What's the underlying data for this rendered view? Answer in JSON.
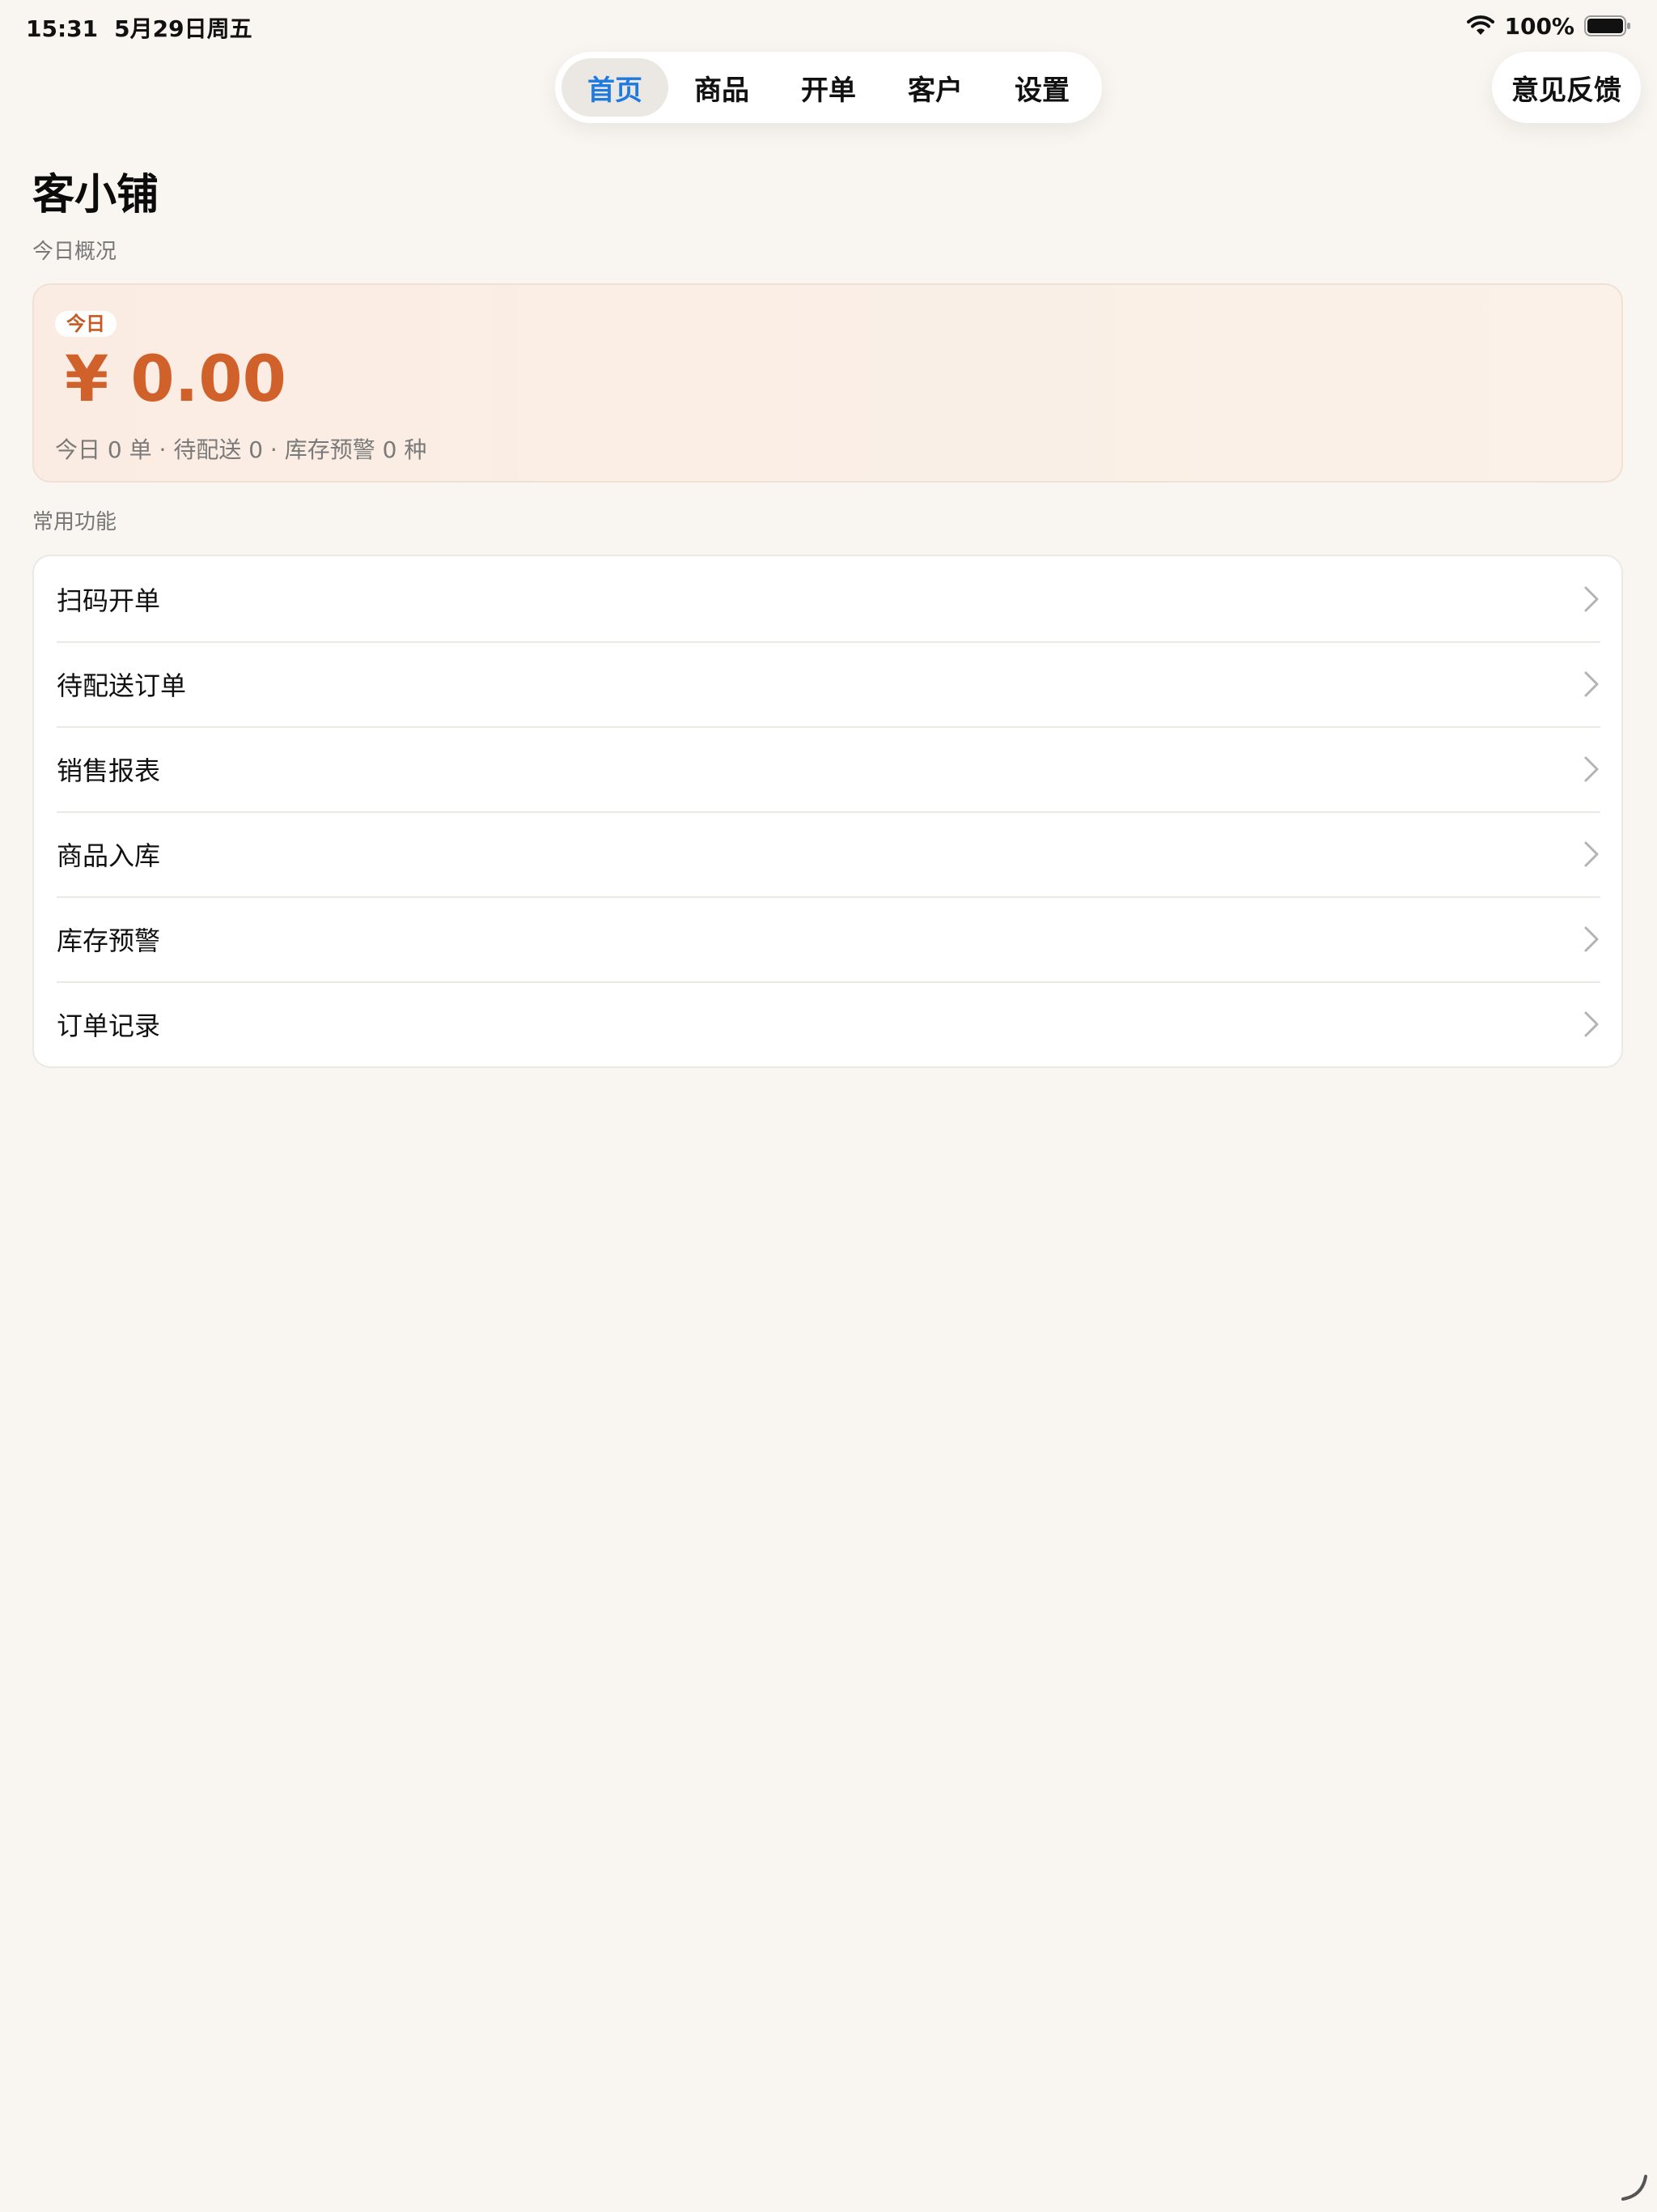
{
  "status_bar": {
    "time": "15:31",
    "date": "5月29日周五",
    "battery": "100%"
  },
  "nav": {
    "tabs": [
      {
        "label": "首页",
        "active": true
      },
      {
        "label": "商品",
        "active": false
      },
      {
        "label": "开单",
        "active": false
      },
      {
        "label": "客户",
        "active": false
      },
      {
        "label": "设置",
        "active": false
      }
    ],
    "feedback_label": "意见反馈"
  },
  "page": {
    "title": "客小铺",
    "overview_label": "今日概况",
    "common_label": "常用功能"
  },
  "summary": {
    "badge": "今日",
    "amount": "¥ 0.00",
    "line": "今日 0 单 · 待配送 0 · 库存预警 0 种"
  },
  "functions": [
    {
      "label": "扫码开单"
    },
    {
      "label": "待配送订单"
    },
    {
      "label": "销售报表"
    },
    {
      "label": "商品入库"
    },
    {
      "label": "库存预警"
    },
    {
      "label": "订单记录"
    }
  ],
  "colors": {
    "accent": "#d0612b",
    "active_tab": "#1e7ae0",
    "background": "#f9f6f1"
  }
}
